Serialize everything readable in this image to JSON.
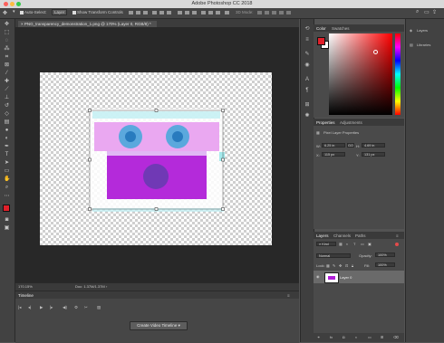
{
  "window": {
    "title": "Adobe Photoshop CC 2018",
    "traffic_colors": [
      "#fc605c",
      "#fdbc40",
      "#34c84a"
    ]
  },
  "options_bar": {
    "auto_select_label": "Auto-Select:",
    "auto_select_value": "Layer",
    "show_transform_label": "Show Transform Controls",
    "mode_3d_label": "3D Mode:"
  },
  "document": {
    "tab_label": "PNG_transparency_demonstration_1.png @ 170% (Layer 0, RGB/8) *"
  },
  "status_bar": {
    "zoom": "170.15%",
    "doc_info": "Doc: 1.37M/1.37M"
  },
  "timeline": {
    "title": "Timeline",
    "create_button": "Create Video Timeline"
  },
  "color_panel": {
    "tabs": [
      "Color",
      "Swatches"
    ],
    "foreground": "#e0202a",
    "background": "#ffffff"
  },
  "right_strip": {
    "items": [
      "Layers",
      "Libraries"
    ]
  },
  "properties_panel": {
    "tabs": [
      "Properties",
      "Adjustments"
    ],
    "section": "Pixel Layer Properties",
    "w_label": "W:",
    "w_value": "6.25 in",
    "go_label": "GO",
    "h_label": "H:",
    "h_value": "4.69 in",
    "x_label": "X:",
    "x_value": "115 px",
    "y_label": "Y:",
    "y_value": "131 px"
  },
  "layers_panel": {
    "tabs": [
      "Layers",
      "Channels",
      "Paths"
    ],
    "kind_label": "Kind",
    "blend_mode": "Normal",
    "opacity_label": "Opacity:",
    "opacity_value": "100%",
    "lock_label": "Lock:",
    "fill_label": "Fill:",
    "fill_value": "100%",
    "layers": [
      {
        "name": "Layer 0"
      }
    ]
  }
}
